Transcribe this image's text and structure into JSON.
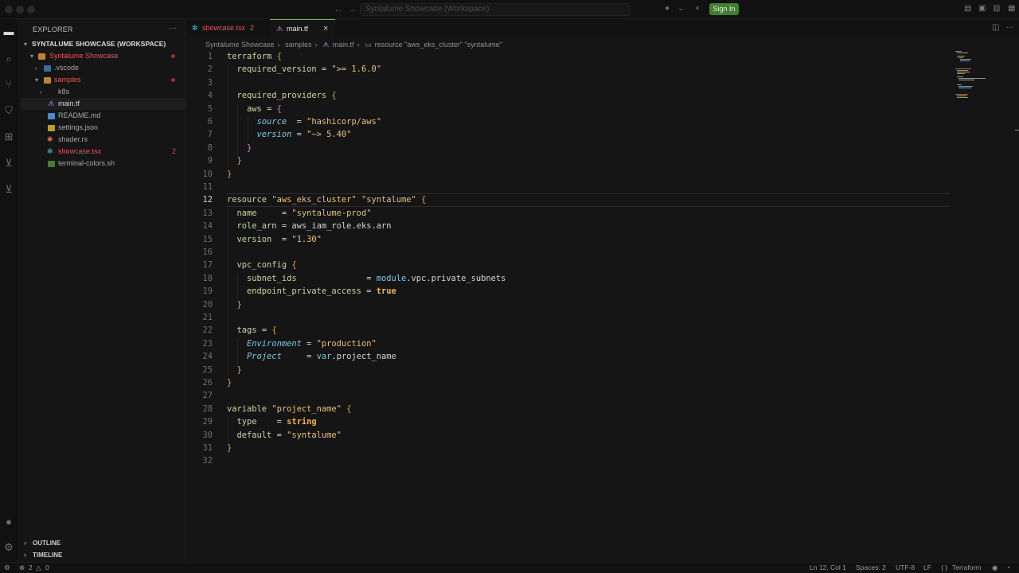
{
  "window": {
    "search_placeholder": "Syntalume Showcase (Workspace)",
    "sign_in": "Sign In"
  },
  "sidebar": {
    "header": "EXPLORER",
    "more": "···",
    "workspace": "SYNTALUME SHOWCASE (WORKSPACE)",
    "tree": [
      {
        "label": "Syntalume Showcase",
        "kind": "folder-open",
        "color": "#e05a5a"
      },
      {
        "label": ".vscode",
        "kind": "folder",
        "color": "#a8a8a8"
      },
      {
        "label": "samples",
        "kind": "folder-open",
        "color": "#e05a5a"
      },
      {
        "label": "k8s",
        "kind": "folder",
        "color": "#a8a8a8"
      },
      {
        "label": "main.tf",
        "kind": "file",
        "color": "#d8d8d8"
      },
      {
        "label": "README.md",
        "kind": "file",
        "color": "#a8a8a8"
      },
      {
        "label": "settings.json",
        "kind": "file",
        "color": "#a8a8a8"
      },
      {
        "label": "shader.rs",
        "kind": "file",
        "color": "#a8a8a8"
      },
      {
        "label": "showcase.tsx",
        "kind": "file",
        "color": "#e05a5a",
        "badge": "2"
      },
      {
        "label": "terminal-colors.sh",
        "kind": "file",
        "color": "#a8a8a8"
      }
    ],
    "outline": "OUTLINE",
    "timeline": "TIMELINE"
  },
  "tabs": [
    {
      "label": "showcase.tsx",
      "badge": "2",
      "color": "#e05a5a"
    },
    {
      "label": "main.tf",
      "close": "×",
      "color": "#e0e0e0"
    }
  ],
  "breadcrumb": [
    "Syntalume Showcase",
    "samples",
    "main.tf",
    "resource \"aws_eks_cluster\" \"syntalume\""
  ],
  "editor": {
    "line_numbers": [
      "1",
      "2",
      "3",
      "4",
      "5",
      "6",
      "7",
      "8",
      "9",
      "10",
      "11",
      "12",
      "13",
      "14",
      "15",
      "16",
      "17",
      "18",
      "19",
      "20",
      "21",
      "22",
      "23",
      "24",
      "25",
      "26",
      "27",
      "28",
      "29",
      "30",
      "31",
      "32"
    ],
    "lines": [
      "terraform {",
      "  required_version = \">= 1.6.0\"",
      "",
      "  required_providers {",
      "    aws = {",
      "      source  = \"hashicorp/aws\"",
      "      version = \"~> 5.40\"",
      "    }",
      "  }",
      "}",
      "",
      "resource \"aws_eks_cluster\" \"syntalume\" {",
      "  name     = \"syntalume-prod\"",
      "  role_arn = aws_iam_role.eks.arn",
      "  version  = \"1.30\"",
      "",
      "  vpc_config {",
      "    subnet_ids              = module.vpc.private_subnets",
      "    endpoint_private_access = true",
      "  }",
      "",
      "  tags = {",
      "    Environment = \"production\"",
      "    Project     = var.project_name",
      "  }",
      "}",
      "",
      "variable \"project_name\" {",
      "  type    = string",
      "  default = \"syntalume\"",
      "}",
      ""
    ]
  },
  "status": {
    "errors": "2",
    "warnings": "0",
    "position": "Ln 12, Col 1",
    "spaces": "Spaces: 2",
    "encoding": "UTF-8",
    "eol": "LF",
    "language": "Terraform"
  },
  "colors": {
    "accent": "#7cb854",
    "error": "#e05a5a",
    "string": "#e5c07b",
    "keyword": "#c7d6a2"
  }
}
